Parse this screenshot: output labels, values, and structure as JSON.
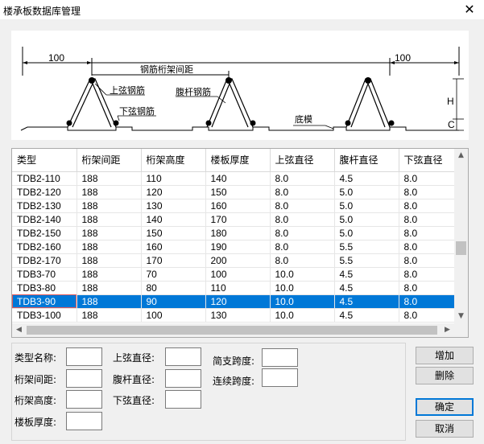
{
  "window": {
    "title": "楼承板数据库管理",
    "close_glyph": "✕"
  },
  "diagram": {
    "dim_left": "100",
    "dim_right": "100",
    "truss_spacing": "钢筋桁架间距",
    "top_chord": "上弦钢筋",
    "web_bar": "腹杆钢筋",
    "bottom_chord": "下弦钢筋",
    "bottom_plate": "底模",
    "height_label": "H",
    "cover_label": "C"
  },
  "table": {
    "columns": [
      "类型",
      "桁架间距",
      "桁架高度",
      "楼板厚度",
      "上弦直径",
      "腹杆直径",
      "下弦直径"
    ],
    "rows": [
      [
        "TDB2-110",
        "188",
        "110",
        "140",
        "8.0",
        "4.5",
        "8.0"
      ],
      [
        "TDB2-120",
        "188",
        "120",
        "150",
        "8.0",
        "5.0",
        "8.0"
      ],
      [
        "TDB2-130",
        "188",
        "130",
        "160",
        "8.0",
        "5.0",
        "8.0"
      ],
      [
        "TDB2-140",
        "188",
        "140",
        "170",
        "8.0",
        "5.0",
        "8.0"
      ],
      [
        "TDB2-150",
        "188",
        "150",
        "180",
        "8.0",
        "5.0",
        "8.0"
      ],
      [
        "TDB2-160",
        "188",
        "160",
        "190",
        "8.0",
        "5.5",
        "8.0"
      ],
      [
        "TDB2-170",
        "188",
        "170",
        "200",
        "8.0",
        "5.5",
        "8.0"
      ],
      [
        "TDB3-70",
        "188",
        "70",
        "100",
        "10.0",
        "4.5",
        "8.0"
      ],
      [
        "TDB3-80",
        "188",
        "80",
        "110",
        "10.0",
        "4.5",
        "8.0"
      ],
      [
        "TDB3-90",
        "188",
        "90",
        "120",
        "10.0",
        "4.5",
        "8.0"
      ],
      [
        "TDB3-100",
        "188",
        "100",
        "130",
        "10.0",
        "4.5",
        "8.0"
      ]
    ],
    "selected_index": 9
  },
  "form": {
    "type_name_label": "类型名称:",
    "truss_spacing_label": "桁架间距:",
    "truss_height_label": "桁架高度:",
    "slab_thickness_label": "楼板厚度:",
    "top_chord_label": "上弦直径:",
    "web_label": "腹杆直径:",
    "bottom_chord_label": "下弦直径:",
    "simple_span_label": "简支跨度:",
    "continuous_span_label": "连续跨度:"
  },
  "buttons": {
    "add": "增加",
    "delete": "删除",
    "ok": "确定",
    "cancel": "取消"
  }
}
